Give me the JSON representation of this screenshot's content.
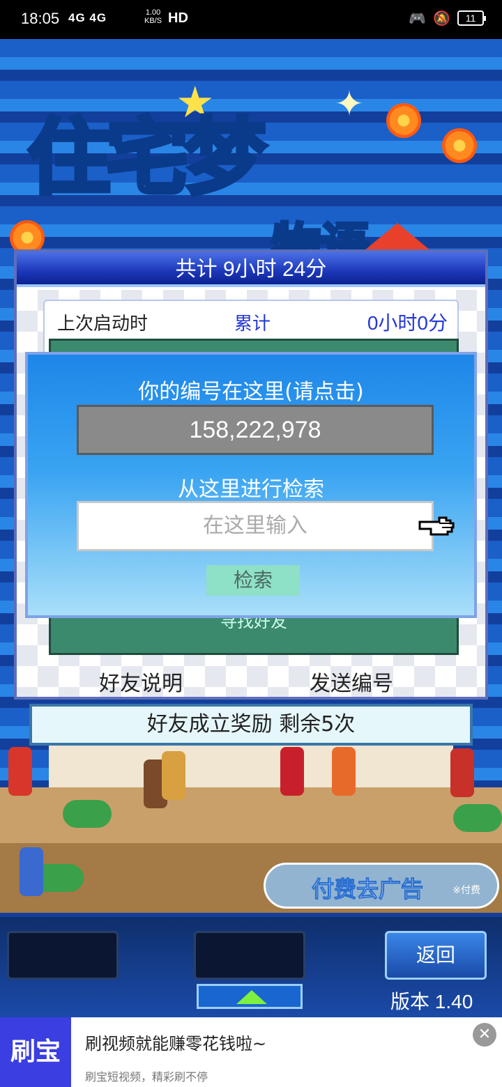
{
  "status_bar": {
    "time": "18:05",
    "network": "4G 4G",
    "speed": "1.00\nKB/S",
    "hd": "HD",
    "battery": "11",
    "icons": [
      "gamepad-icon",
      "mute-bell-icon",
      "wifi-icon"
    ]
  },
  "logo": {
    "title": "住宅梦",
    "subtitle": "物语"
  },
  "main_window": {
    "title": "共计 9小时 24分",
    "last_launch_label": "上次启动时",
    "total_label": "累计",
    "total_value": "0小时0分",
    "find_friend_label": "寻找好友",
    "friend_help_button": "好友说明",
    "send_id_button": "发送编号"
  },
  "dialog": {
    "title": "你的编号在这里(请点击)",
    "player_id": "158,222,978",
    "search_label": "从这里进行检索",
    "search_placeholder": "在这里输入",
    "search_button": "检索"
  },
  "reward_bar": {
    "text": "好友成立奖励 剩余5次"
  },
  "remove_ads": {
    "label": "付费去广告",
    "note": "※付费"
  },
  "bottom_panel": {
    "back_button": "返回",
    "version": "版本 1.40"
  },
  "ad_banner": {
    "logo": "刷宝",
    "title": "刷视频就能赚零花钱啦~",
    "subtitle": "刷宝短视频，精彩刷不停",
    "close": "✕"
  },
  "colors": {
    "title_bar": "#1c37b8",
    "total_text": "#2437d8",
    "id_field": "#8a8a8a",
    "search_button": "#8ee0c6",
    "ad_logo": "#3b3ee0"
  }
}
